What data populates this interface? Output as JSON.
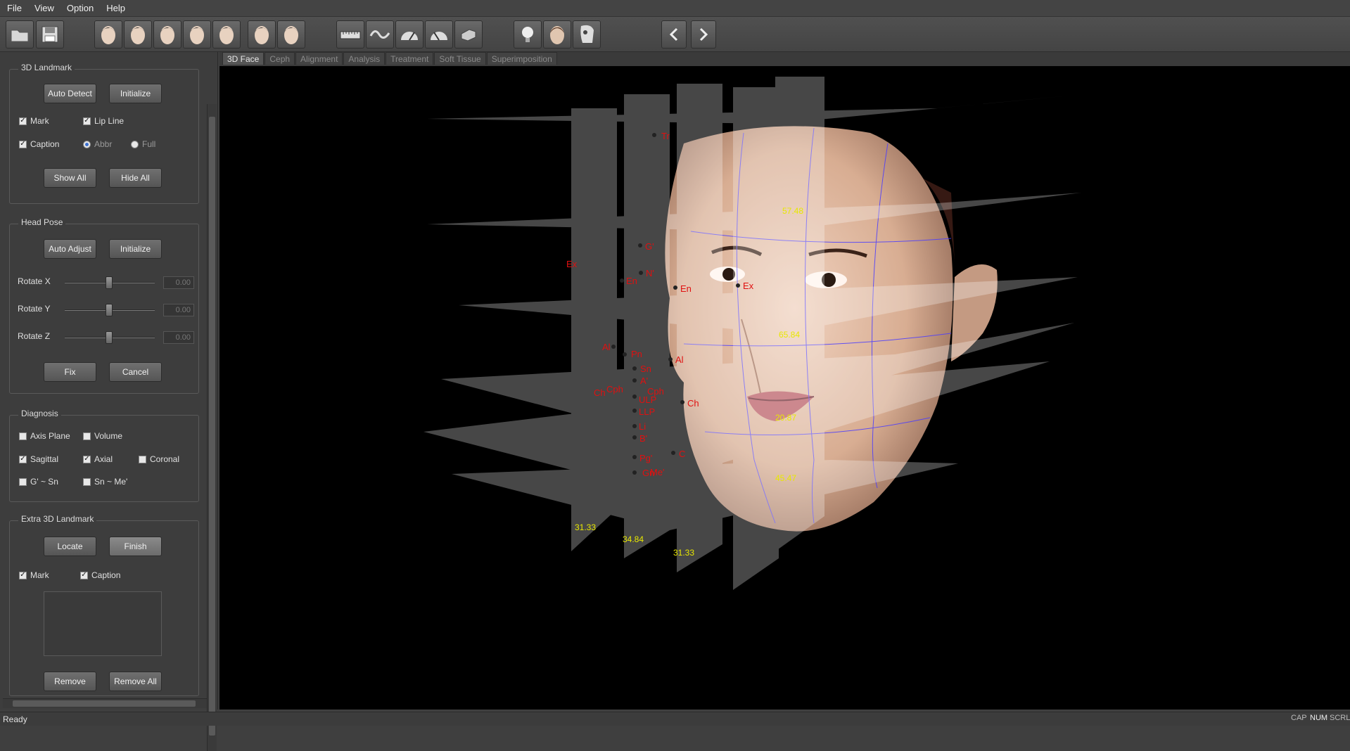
{
  "menu": [
    "File",
    "View",
    "Option",
    "Help"
  ],
  "toolbar": {
    "icons": [
      "open-folder-icon",
      "save-icon",
      "face-front-icon",
      "face-left-icon",
      "face-center-icon",
      "face-right-icon",
      "face-side-icon",
      "face-up-icon",
      "face-down-icon",
      "ruler-icon",
      "wave-icon",
      "gauge-icon",
      "gauge-wide-icon",
      "block-icon",
      "bulb-icon",
      "head-icon",
      "skull-icon",
      "arrow-left-icon",
      "arrow-right-icon"
    ]
  },
  "landmark": {
    "title": "3D Landmark",
    "auto_detect": "Auto Detect",
    "initialize": "Initialize",
    "mark": "Mark",
    "lip_line": "Lip Line",
    "caption": "Caption",
    "abbr": "Abbr",
    "full": "Full",
    "show_all": "Show All",
    "hide_all": "Hide All"
  },
  "headpose": {
    "title": "Head Pose",
    "auto_adjust": "Auto Adjust",
    "initialize": "Initialize",
    "rotate_x": "Rotate X",
    "rotate_y": "Rotate Y",
    "rotate_z": "Rotate Z",
    "value_x": "0.00",
    "value_y": "0.00",
    "value_z": "0.00",
    "fix": "Fix",
    "cancel": "Cancel"
  },
  "diagnosis": {
    "title": "Diagnosis",
    "axis_plane": "Axis Plane",
    "volume": "Volume",
    "sagittal": "Sagittal",
    "axial": "Axial",
    "coronal": "Coronal",
    "g_sn": "G' ~ Sn",
    "sn_me": "Sn ~ Me'"
  },
  "extra": {
    "title": "Extra 3D Landmark",
    "locate": "Locate",
    "finish": "Finish",
    "mark": "Mark",
    "caption": "Caption",
    "remove": "Remove",
    "remove_all": "Remove All"
  },
  "tabs": [
    "3D Face",
    "Ceph",
    "Alignment",
    "Analysis",
    "Treatment",
    "Soft Tissue",
    "Superimposition"
  ],
  "landmarks": [
    "Tr",
    "G'",
    "N'",
    "Ex",
    "En",
    "En",
    "Ex",
    "Al",
    "Pn",
    "Al",
    "Sn",
    "A'",
    "Cph",
    "Cph",
    "Ch",
    "ULP",
    "Ch",
    "LLP",
    "Li",
    "B'",
    "Pg'",
    "Gn'",
    "Me'",
    "C"
  ],
  "measurements": [
    "57.48",
    "65.84",
    "20.87",
    "45.47",
    "31.33",
    "34.84",
    "31.33"
  ],
  "status": "Ready",
  "indicators": [
    "CAP",
    "NUM",
    "SCRL"
  ],
  "colors": {
    "landmark": "#e01010",
    "measure": "#e8e800",
    "contour": "#4a3cff"
  }
}
